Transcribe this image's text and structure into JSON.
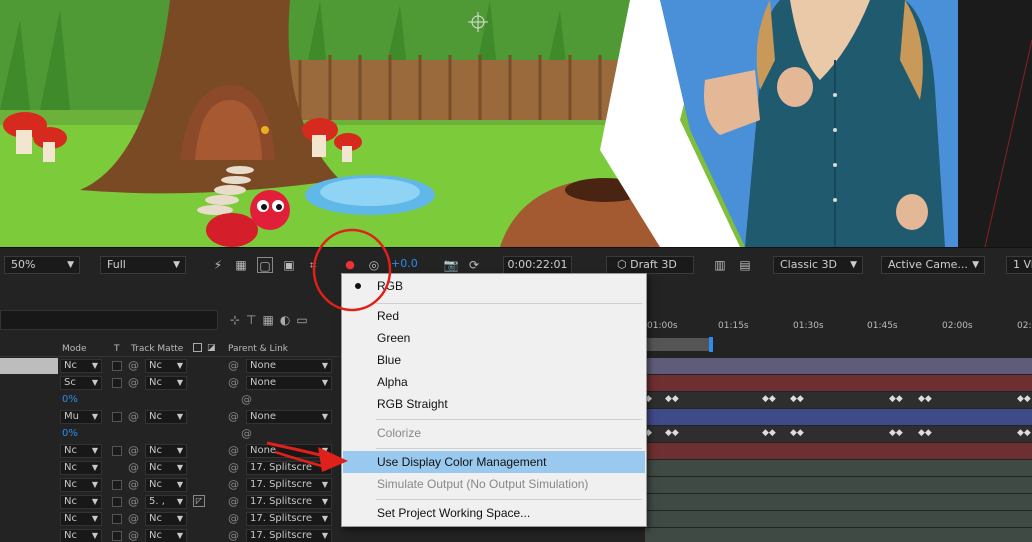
{
  "viewer": {
    "zoom": "50%",
    "resolution": "Full",
    "exposure": "+0.0",
    "timecode": "0:00:22:01",
    "draft3d": "Draft 3D",
    "renderer": "Classic 3D",
    "camera": "Active Came...",
    "views": "1 Vi"
  },
  "timeline": {
    "headers": {
      "mode": "Mode",
      "t": "T",
      "track_matte": "Track Matte",
      "parent": "Parent & Link"
    },
    "ruler": [
      "01:00s",
      "01:15s",
      "01:30s",
      "01:45s",
      "02:00s",
      "02:"
    ],
    "rows": [
      {
        "mode": "Nc",
        "matte": "Nc",
        "parent": "None"
      },
      {
        "mode": "Sc",
        "matte": "Nc",
        "parent": "None"
      },
      {
        "pct": "0%"
      },
      {
        "mode": "Mu",
        "matte": "Nc",
        "parent": "None"
      },
      {
        "pct": "0%"
      },
      {
        "mode": "Nc",
        "matte": "Nc",
        "parent": "None"
      },
      {
        "mode": "Nc",
        "matte": "Nc",
        "parent": "17. Splitscre"
      },
      {
        "mode": "Nc",
        "matte": "Nc",
        "parent": "17. Splitscre"
      },
      {
        "mode": "Nc",
        "matte": "5. ,",
        "parent": "17. Splitscre"
      },
      {
        "mode": "Nc",
        "matte": "Nc",
        "parent": "17. Splitscre"
      },
      {
        "mode": "Nc",
        "matte": "Nc",
        "parent": "17. Splitscre"
      }
    ]
  },
  "menu": {
    "items": [
      {
        "label": "RGB",
        "checked": true,
        "disabled": false
      },
      {
        "label": "Red",
        "disabled": false
      },
      {
        "label": "Green",
        "disabled": false
      },
      {
        "label": "Blue",
        "disabled": false
      },
      {
        "label": "Alpha",
        "disabled": false
      },
      {
        "label": "RGB Straight",
        "disabled": false
      },
      {
        "label": "Colorize",
        "disabled": true
      },
      {
        "label": "Use Display Color Management",
        "highlighted": true,
        "disabled": false
      },
      {
        "label": "Simulate Output (No Output Simulation)",
        "disabled": true
      },
      {
        "label": "Set Project Working Space...",
        "disabled": false
      }
    ]
  },
  "colors": {
    "accent": "#2d8cf0",
    "annotation": "#e0201a",
    "menu_highlight": "#99c9ef"
  }
}
